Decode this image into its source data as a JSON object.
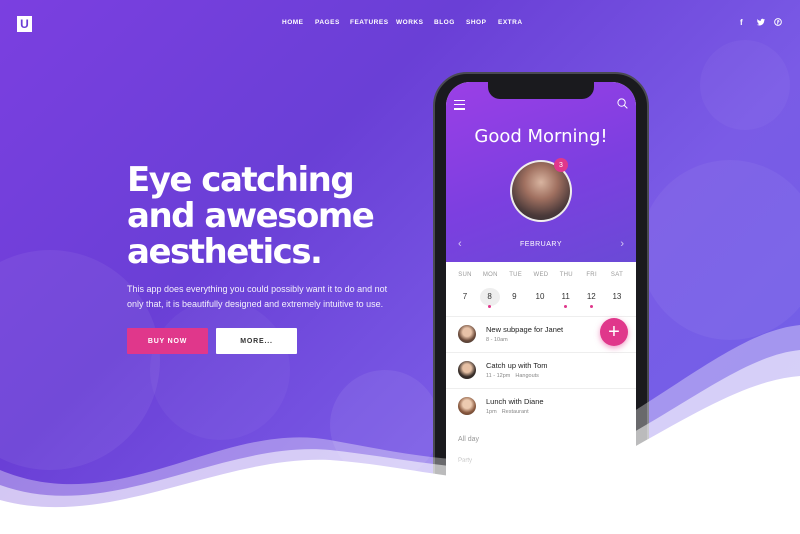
{
  "brand": {
    "logo_letter": "U"
  },
  "nav": {
    "items": [
      "HOME",
      "PAGES",
      "FEATURES",
      "WORKS",
      "BLOG",
      "SHOP",
      "EXTRA"
    ]
  },
  "social": {
    "facebook": "f",
    "twitter": "t",
    "pinterest": "p"
  },
  "hero": {
    "headline": [
      "Eye catching",
      "and awesome",
      "aesthetics."
    ],
    "description": "This app does everything you could possibly want it to do and not only that, it is beautifully designed and extremely intuitive to use.",
    "buy_label": "BUY NOW",
    "more_label": "MORE..."
  },
  "app": {
    "greeting": "Good Morning!",
    "badge_count": "3",
    "month": "FEBRUARY",
    "weekdays": [
      "SUN",
      "MON",
      "TUE",
      "WED",
      "THU",
      "FRI",
      "SAT"
    ],
    "dates": [
      "7",
      "8",
      "9",
      "10",
      "11",
      "12",
      "13"
    ],
    "selected_date": "8",
    "events": [
      {
        "title": "New subpage for Janet",
        "time": "8 - 10am",
        "place": ""
      },
      {
        "title": "Catch up with Tom",
        "time": "11 - 12pm",
        "place": "Hangouts"
      },
      {
        "title": "Lunch with Diane",
        "time": "1pm",
        "place": "Restaurant"
      }
    ],
    "fab_label": "+",
    "all_day_label": "All day",
    "faded_label": "Party"
  },
  "colors": {
    "accent": "#e0378b",
    "brand": "#6a3fd6"
  }
}
